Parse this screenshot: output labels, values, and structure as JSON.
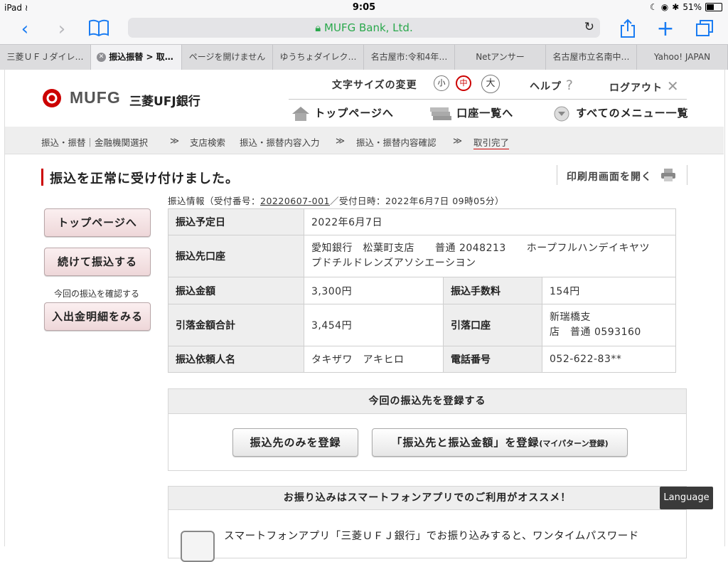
{
  "status_bar": {
    "device": "iPad",
    "time": "9:05",
    "battery": "51%"
  },
  "browser": {
    "url_display": "MUFG Bank, Ltd.",
    "tabs": [
      {
        "label": "三菱ＵＦＪダイレ…"
      },
      {
        "label": "振込振替 > 取…"
      },
      {
        "label": "ページを開けません"
      },
      {
        "label": "ゆうちょダイレク…"
      },
      {
        "label": "名古屋市:令和4年…"
      },
      {
        "label": "Netアンサー"
      },
      {
        "label": "名古屋市立名南中…"
      },
      {
        "label": "Yahoo! JAPAN"
      }
    ]
  },
  "header": {
    "logo_text": "MUFG",
    "bank_name": "三菱UFJ銀行",
    "font_size_label": "文字サイズの変更",
    "size_small": "小",
    "size_medium": "中",
    "size_large": "大",
    "help": "ヘルプ",
    "logout": "ログアウト",
    "nav_top": "トップページへ",
    "nav_accounts": "口座一覧へ",
    "nav_menu": "すべてのメニュー一覧"
  },
  "breadcrumb": {
    "step1": "振込・振替｜金融機関選択",
    "step2": "支店検索",
    "step3": "振込・振替内容入力",
    "step4": "振込・振替内容確認",
    "step5": "取引完了",
    "sep": "≫"
  },
  "main": {
    "title": "振込を正常に受け付けました。",
    "print_label": "印刷用画面を開く",
    "info_prefix": "振込情報（受付番号：",
    "receipt_no": "20220607-001",
    "info_suffix": "／受付日時：2022年6月7日 09時05分）",
    "buttons": {
      "top": "トップページへ",
      "continue": "続けて振込する",
      "confirm_note": "今回の振込を確認する",
      "details": "入出金明細をみる"
    },
    "table": {
      "date_label": "振込予定日",
      "date_value": "2022年6月7日",
      "dest_label": "振込先口座",
      "dest_line1": "愛知銀行　松葉町支店　　普通 2048213　　ホープフルハンデイキヤツ",
      "dest_line2": "プドチルドレンズアソシエーシヨン",
      "amount_label": "振込金額",
      "amount_value": "3,300円",
      "fee_label": "振込手数料",
      "fee_value": "154円",
      "total_label": "引落金額合計",
      "total_value": "3,454円",
      "debit_label": "引落口座",
      "debit_line1": "新瑞橋支",
      "debit_line2": "店　普通 0593160",
      "requester_label": "振込依頼人名",
      "requester_value": "タキザワ　アキヒロ",
      "phone_label": "電話番号",
      "phone_value": "052-622-83**"
    },
    "register": {
      "heading": "今回の振込先を登録する",
      "btn_dest_only": "振込先のみを登録",
      "btn_dest_amount": "「振込先と振込金額」を登録",
      "btn_dest_amount_note": "(マイパターン登録)"
    },
    "app": {
      "heading": "お振り込みはスマートフォンアプリでのご利用がオススメ！",
      "text": "スマートフォンアプリ「三菱ＵＦＪ銀行」でお振り込みすると、ワンタイムパスワード"
    },
    "language_button": "Language"
  },
  "colors": {
    "brand_red": "#cc0000",
    "url_green": "#2aa84c",
    "ios_blue": "#1a7cf2"
  }
}
